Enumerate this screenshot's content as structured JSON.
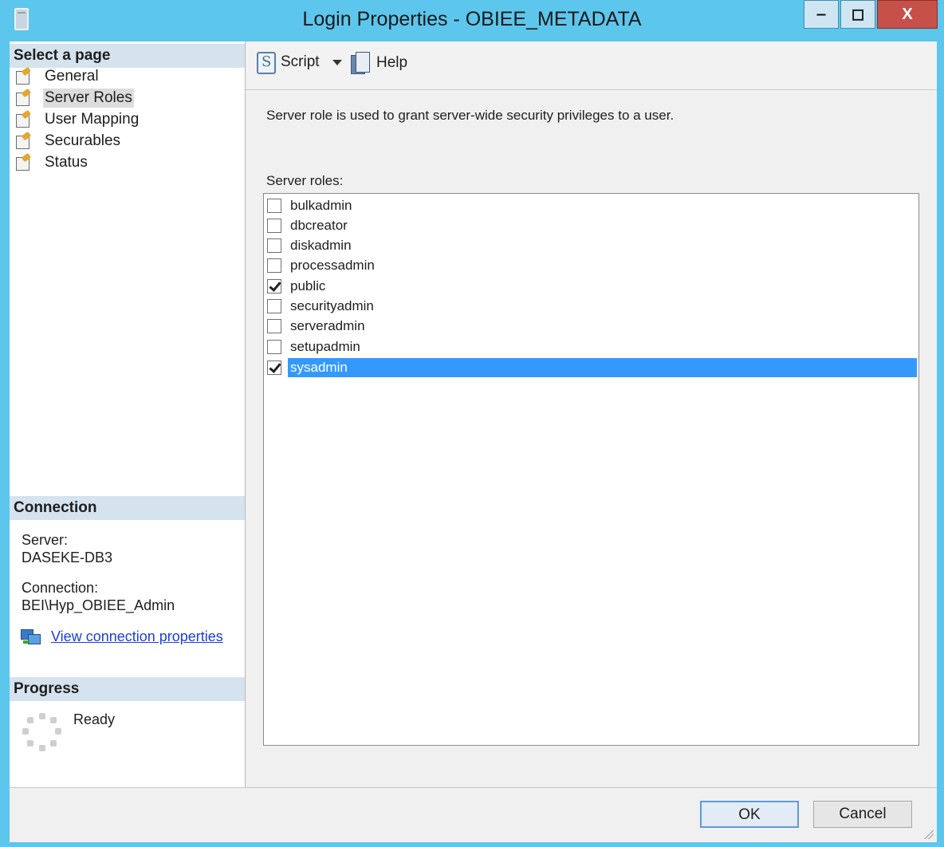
{
  "window": {
    "title": "Login Properties - OBIEE_METADATA",
    "minimize_label": "‒",
    "maximize_label": "◻",
    "close_label": "X"
  },
  "left_pane": {
    "select_page_header": "Select a page",
    "pages": [
      {
        "label": "General",
        "icon": "page-settings-icon"
      },
      {
        "label": "Server Roles",
        "icon": "page-settings-icon",
        "selected": true
      },
      {
        "label": "User Mapping",
        "icon": "page-settings-icon"
      },
      {
        "label": "Securables",
        "icon": "page-settings-icon"
      },
      {
        "label": "Status",
        "icon": "page-settings-icon"
      }
    ],
    "connection_header": "Connection",
    "server_label": "Server:",
    "server_value": "DASEKE-DB3",
    "connection_label": "Connection:",
    "connection_value": "BEI\\Hyp_OBIEE_Admin",
    "view_connection_link": "View connection properties",
    "progress_header": "Progress",
    "progress_status": "Ready"
  },
  "toolbar": {
    "script_label": "Script",
    "help_label": "Help"
  },
  "main": {
    "description": "Server role is used to grant server-wide security privileges to a user.",
    "roles_label": "Server roles:",
    "roles": [
      {
        "label": "bulkadmin",
        "checked": false
      },
      {
        "label": "dbcreator",
        "checked": false
      },
      {
        "label": "diskadmin",
        "checked": false
      },
      {
        "label": "processadmin",
        "checked": false
      },
      {
        "label": "public",
        "checked": true
      },
      {
        "label": "securityadmin",
        "checked": false
      },
      {
        "label": "serveradmin",
        "checked": false
      },
      {
        "label": "setupadmin",
        "checked": false
      },
      {
        "label": "sysadmin",
        "checked": true,
        "selected": true
      }
    ]
  },
  "footer": {
    "ok_label": "OK",
    "cancel_label": "Cancel"
  },
  "colors": {
    "window_frame": "#5dc6ec",
    "selection": "#3399ff",
    "section_header": "#d5e3ef",
    "link": "#1a3fd6"
  }
}
